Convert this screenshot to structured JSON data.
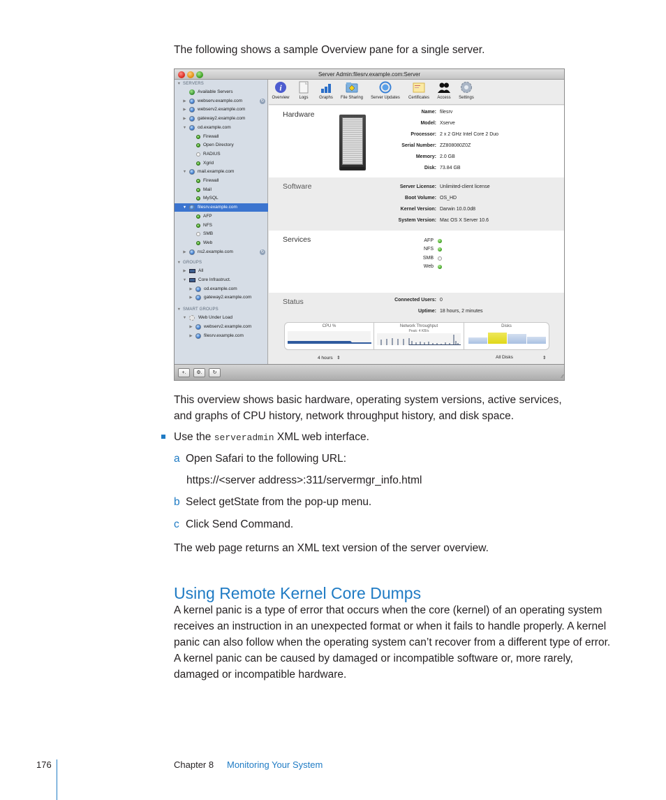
{
  "intro_text": "The following shows a sample Overview pane for a single server.",
  "window": {
    "title": "Server Admin:filesrv.example.com:Server",
    "sidebar": {
      "sections": {
        "servers": "SERVERS",
        "groups": "GROUPS",
        "smart_groups": "SMART GROUPS"
      },
      "items": [
        {
          "label": "Available Servers",
          "type": "available"
        },
        {
          "label": "webserv.example.com",
          "type": "server",
          "disclosure": "collapsed",
          "badge": true
        },
        {
          "label": "webserv2.example.com",
          "type": "server",
          "disclosure": "collapsed"
        },
        {
          "label": "gateway2.example.com",
          "type": "server",
          "disclosure": "collapsed"
        },
        {
          "label": "od.example.com",
          "type": "server",
          "disclosure": "expanded"
        },
        {
          "label": "Firewall",
          "type": "service",
          "status": "on"
        },
        {
          "label": "Open Directory",
          "type": "service",
          "status": "on"
        },
        {
          "label": "RADIUS",
          "type": "service",
          "status": "off"
        },
        {
          "label": "Xgrid",
          "type": "service",
          "status": "on"
        },
        {
          "label": "mail.example.com",
          "type": "server",
          "disclosure": "expanded"
        },
        {
          "label": "Firewall",
          "type": "service",
          "status": "on"
        },
        {
          "label": "Mail",
          "type": "service",
          "status": "on"
        },
        {
          "label": "MySQL",
          "type": "service",
          "status": "on"
        },
        {
          "label": "filesrv.example.com",
          "type": "server",
          "disclosure": "expanded",
          "selected": true
        },
        {
          "label": "AFP",
          "type": "service",
          "status": "on"
        },
        {
          "label": "NFS",
          "type": "service",
          "status": "on"
        },
        {
          "label": "SMB",
          "type": "service",
          "status": "off"
        },
        {
          "label": "Web",
          "type": "service",
          "status": "on"
        },
        {
          "label": "ns2.example.com",
          "type": "server",
          "disclosure": "collapsed",
          "badge": true
        }
      ],
      "group_items": [
        {
          "label": "All",
          "disclosure": "collapsed"
        },
        {
          "label": "Core Infrastruct.",
          "disclosure": "expanded"
        },
        {
          "label": "od.example.com",
          "disclosure": "collapsed"
        },
        {
          "label": "gateway2.example.com",
          "disclosure": "collapsed"
        }
      ],
      "smart_group_items": [
        {
          "label": "Web Under Load",
          "disclosure": "expanded"
        },
        {
          "label": "webserv2.example.com",
          "disclosure": "collapsed"
        },
        {
          "label": "filesrv.example.com",
          "disclosure": "collapsed"
        }
      ]
    },
    "toolbar": [
      {
        "label": "Overview",
        "icon": "info-icon"
      },
      {
        "label": "Logs",
        "icon": "logs-icon"
      },
      {
        "label": "Graphs",
        "icon": "graphs-icon"
      },
      {
        "label": "File Sharing",
        "icon": "file-sharing-icon"
      },
      {
        "label": "Server Updates",
        "icon": "server-updates-icon"
      },
      {
        "label": "Certificates",
        "icon": "certificate-icon"
      },
      {
        "label": "Access",
        "icon": "access-icon"
      },
      {
        "label": "Settings",
        "icon": "settings-gear-icon"
      }
    ],
    "hardware": {
      "title": "Hardware",
      "fields": [
        {
          "key": "Name:",
          "value": "filesrv"
        },
        {
          "key": "Model:",
          "value": "Xserve"
        },
        {
          "key": "Processor:",
          "value": "2 x 2 GHz Intel Core 2 Duo"
        },
        {
          "key": "Serial Number:",
          "value": "ZZ808080Z0Z"
        },
        {
          "key": "Memory:",
          "value": "2.0 GB"
        },
        {
          "key": "Disk:",
          "value": "73.84 GB"
        }
      ]
    },
    "software": {
      "title": "Software",
      "fields": [
        {
          "key": "Server License:",
          "value": "Unlimited-client license"
        },
        {
          "key": "Boot Volume:",
          "value": "OS_HD"
        },
        {
          "key": "Kernel Version:",
          "value": "Darwin 10.0.0d8"
        },
        {
          "key": "System Version:",
          "value": "Mac OS X Server 10.6"
        }
      ]
    },
    "services": {
      "title": "Services",
      "items": [
        {
          "label": "AFP",
          "status": "on"
        },
        {
          "label": "NFS",
          "status": "on"
        },
        {
          "label": "SMB",
          "status": "off"
        },
        {
          "label": "Web",
          "status": "on"
        }
      ]
    },
    "status": {
      "title": "Status",
      "fields": [
        {
          "key": "Connected Users:",
          "value": "0"
        },
        {
          "key": "Uptime:",
          "value": "18 hours, 2 minutes"
        }
      ],
      "graphs": {
        "cpu_title": "CPU %",
        "network_title": "Network Throughput",
        "network_peak": "Peak: 4 KB/s",
        "disks_title": "Disks",
        "disk_colors": [
          "#a9c0e2",
          "#e0d819",
          "#a9c0e2",
          "#a9c0e2"
        ]
      },
      "time_popup": "4 hours",
      "disk_popup": "All Disks"
    },
    "bottom_buttons": [
      {
        "label": "+.",
        "icon": "add-icon"
      },
      {
        "label": "⚙.",
        "icon": "action-gear-icon"
      },
      {
        "label": "↻",
        "icon": "refresh-icon"
      }
    ]
  },
  "caption": "This overview shows basic hardware, operating system versions, active services, and graphs of CPU history, network throughput history, and disk space.",
  "bullet": {
    "prefix": "Use the ",
    "code": "serveradmin",
    "suffix": " XML web interface."
  },
  "steps": [
    {
      "letter": "a",
      "text": "Open Safari to the following URL:"
    },
    {
      "letter": "b",
      "text": "Select getState from the pop-up menu."
    },
    {
      "letter": "c",
      "text": "Click Send Command."
    }
  ],
  "url": "https://<server address>:311/servermgr_info.html",
  "result_text": "The web page returns an XML text version of the server overview.",
  "section_heading": "Using Remote Kernel Core Dumps",
  "section_body": "A kernel panic is a type of error that occurs when the core (kernel) of an operating system receives an instruction in an unexpected format or when it fails to handle properly. A kernel panic can also follow when the operating system can’t recover from a different type of error. A kernel panic can be caused by damaged or incompatible software or, more rarely, damaged or incompatible hardware.",
  "footer": {
    "page_number": "176",
    "chapter": "Chapter 8",
    "chapter_title": "Monitoring Your System"
  },
  "colors": {
    "accent": "#1f7bc4",
    "selection": "#3b74cf",
    "status_on": "#3a9a1e"
  }
}
